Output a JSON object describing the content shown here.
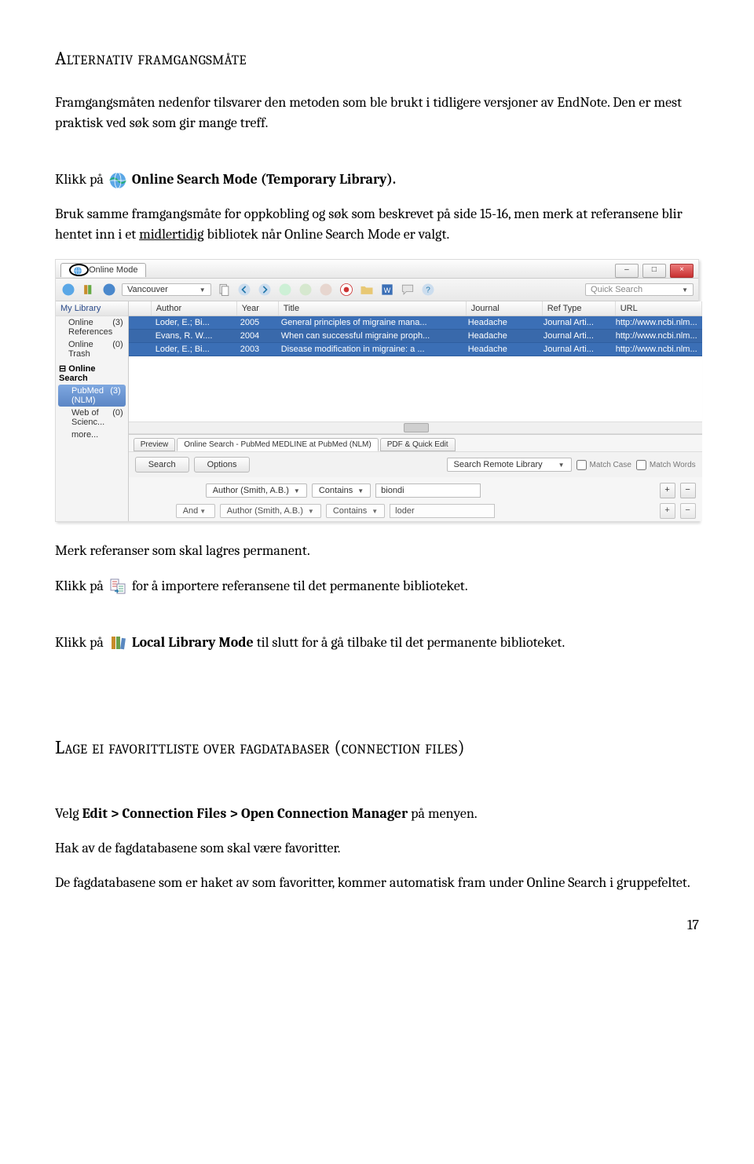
{
  "heading1": "Alternativ framgangsmåte",
  "intro_p1": "Framgangsmåten nedenfor tilsvarer den metoden som ble brukt i tidligere versjoner av EndNote. Den er mest praktisk ved søk som gir mange treff.",
  "click_on": "Klikk på",
  "online_search_mode_label": "Online Search Mode (Temporary Library).",
  "desc_p2a": "Bruk samme framgangsmåte for oppkobling og søk som beskrevet på side 15-16, men merk at referansene blir hentet inn i et ",
  "desc_p2_mid": "midlertidig",
  "desc_p2b": " bibliotek når Online Search Mode er valgt.",
  "after1": "Merk referanser som skal lagres permanent.",
  "after2": " for å importere referansene til det permanente biblioteket.",
  "after3a": "Local Library Mode",
  "after3b": " til slutt for å gå tilbake til det permanente biblioteket.",
  "heading2": "Lage ei favorittliste over fagdatabaser (connection files)",
  "p3a": "Velg ",
  "p3b": "Edit > Connection Files > Open Connection Manager",
  "p3c": " på menyen.",
  "p4": "Hak av de fagdatabasene som skal være favoritter.",
  "p5": "De fagdatabasene som er haket av som favoritter, kommer automatisk fram under Online Search i gruppefeltet.",
  "pageno": "17",
  "shot": {
    "tab_label": "Online Mode",
    "toolbar_style": "Vancouver",
    "quicksearch": "Quick Search",
    "sidebar": {
      "head": "My Library",
      "items": [
        {
          "label": "Online References",
          "count": "(3)"
        },
        {
          "label": "Online Trash",
          "count": "(0)"
        }
      ],
      "group": "Online Search",
      "subs": [
        {
          "label": "PubMed (NLM)",
          "count": "(3)",
          "sel": true
        },
        {
          "label": "Web of Scienc...",
          "count": "(0)",
          "sel": false
        },
        {
          "label": "more...",
          "count": "",
          "sel": false
        }
      ]
    },
    "grid": {
      "cols": [
        "",
        "Author",
        "Year",
        "Title",
        "Journal",
        "Ref Type",
        "URL"
      ],
      "rows": [
        [
          "",
          "Loder, E.; Bi...",
          "2005",
          "General principles of migraine mana...",
          "Headache",
          "Journal Arti...",
          "http://www.ncbi.nlm..."
        ],
        [
          "",
          "Evans, R. W....",
          "2004",
          "When can successful migraine proph...",
          "Headache",
          "Journal Arti...",
          "http://www.ncbi.nlm..."
        ],
        [
          "",
          "Loder, E.; Bi...",
          "2003",
          "Disease modification in migraine: a ...",
          "Headache",
          "Journal Arti...",
          "http://www.ncbi.nlm..."
        ]
      ]
    },
    "bp": {
      "tabs": [
        "Preview",
        "Online Search - PubMed MEDLINE at PubMed (NLM)",
        "PDF & Quick Edit"
      ],
      "search": "Search",
      "options": "Options",
      "remote": "Search Remote Library",
      "match_case": "Match Case",
      "match_words": "Match Words",
      "field1": "Author (Smith, A.B.)",
      "contains": "Contains",
      "val1": "biondi",
      "and": "And",
      "field2": "Author (Smith, A.B.)",
      "val2": "loder"
    }
  }
}
